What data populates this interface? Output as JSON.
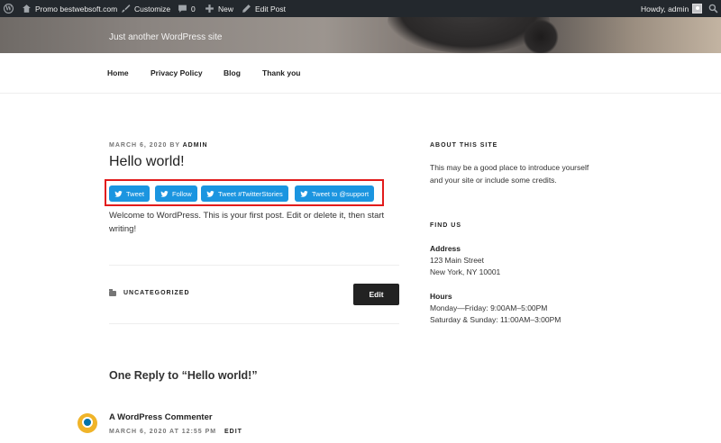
{
  "admin_bar": {
    "site_name": "Promo bestwebsoft.com",
    "customize": "Customize",
    "comments_count": "0",
    "new": "New",
    "edit_post": "Edit Post",
    "howdy": "Howdy, admin"
  },
  "header": {
    "tagline": "Just another WordPress site"
  },
  "nav": {
    "items": [
      "Home",
      "Privacy Policy",
      "Blog",
      "Thank you"
    ]
  },
  "post": {
    "date": "MARCH 6, 2020",
    "by": "BY",
    "author": "ADMIN",
    "title": "Hello world!",
    "buttons": [
      "Tweet",
      "Follow",
      "Tweet #TwitterStories",
      "Tweet to @support"
    ],
    "body": "Welcome to WordPress. This is your first post. Edit or delete it, then start writing!",
    "category": "UNCATEGORIZED",
    "edit_label": "Edit"
  },
  "comments": {
    "title": "One Reply to “Hello world!”",
    "author": "A WordPress Commenter",
    "date": "MARCH 6, 2020 AT 12:55 PM",
    "edit": "EDIT"
  },
  "sidebar": {
    "about_title": "ABOUT THIS SITE",
    "about_line1": "This may be a good place to introduce yourself",
    "about_line2": "and your site or include some credits.",
    "find_title": "FIND US",
    "address_label": "Address",
    "address_line1": "123 Main Street",
    "address_line2": "New York, NY 10001",
    "hours_label": "Hours",
    "hours_line1": "Monday—Friday: 9:00AM–5:00PM",
    "hours_line2": "Saturday & Sunday: 11:00AM–3:00PM"
  },
  "colors": {
    "admin_bar_bg": "#23282d",
    "twitter_blue": "#1b95e0",
    "highlight_red": "#e21b1b",
    "edit_button_bg": "#222222"
  }
}
